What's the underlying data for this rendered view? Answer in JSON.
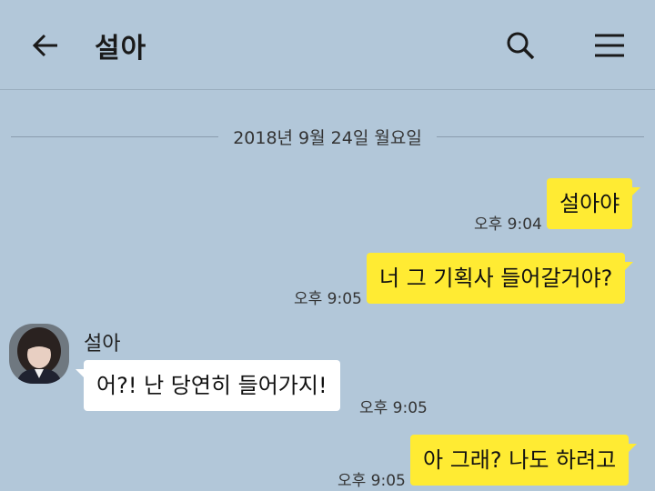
{
  "header": {
    "title": "설아",
    "back_icon": "arrow-left-icon",
    "search_icon": "search-icon",
    "menu_icon": "hamburger-menu-icon"
  },
  "date_divider": "2018년 9월 24일 월요일",
  "messages": [
    {
      "sender": "me",
      "text": "설아야",
      "time": "오후 9:04"
    },
    {
      "sender": "me",
      "text": "너 그 기획사 들어갈거야?",
      "time": "오후 9:05"
    },
    {
      "sender": "other",
      "name": "설아",
      "text": "어?! 난 당연히 들어가지!",
      "time": "오후 9:05"
    },
    {
      "sender": "me",
      "text": "아 그래? 나도 하려고",
      "time": "오후 9:05"
    }
  ],
  "colors": {
    "background": "#b2c7d9",
    "my_bubble": "#ffeb33",
    "other_bubble": "#ffffff"
  }
}
